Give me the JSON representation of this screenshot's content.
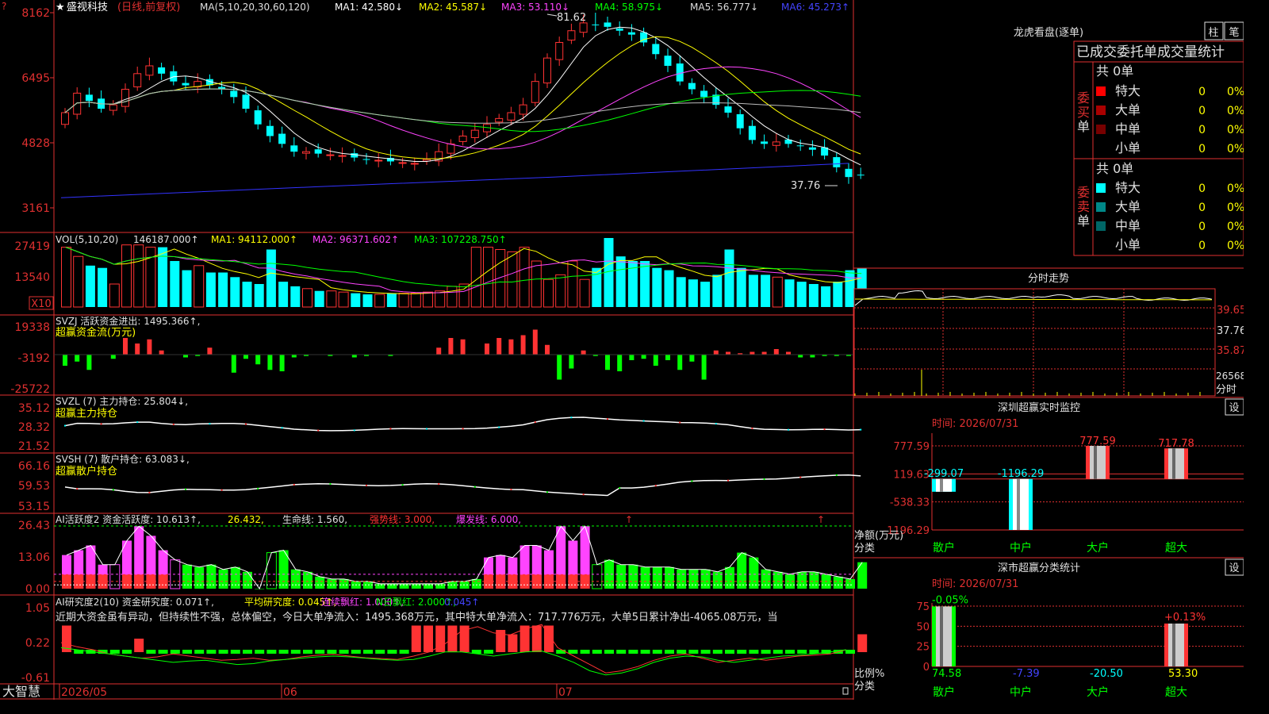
{
  "colors": {
    "up": "#ff3333",
    "down": "#00ffff",
    "axis": "#e03030",
    "text": "#e0e0e0",
    "yellow": "#ffff00",
    "green": "#00ff00",
    "magenta": "#ff44ff",
    "white": "#ffffff",
    "blue": "#3333ff"
  },
  "header": {
    "star": "★",
    "stock": "盛视科技",
    "mode": "(日线,前复权)",
    "ma_prefix": "MA(5,10,20,30,60,120)",
    "ma": [
      {
        "label": "MA1: 42.580↓",
        "color": "#ffffff"
      },
      {
        "label": "MA2: 45.587↓",
        "color": "#ffff00"
      },
      {
        "label": "MA3: 53.110↓",
        "color": "#ff44ff"
      },
      {
        "label": "MA4: 58.975↓",
        "color": "#00ff00"
      },
      {
        "label": "MA5: 56.777↓",
        "color": "#dddddd"
      },
      {
        "label": "MA6: 45.273↑",
        "color": "#4444ff"
      }
    ],
    "high_mark": "81.62",
    "low_mark": "37.76"
  },
  "price_axis": [
    "8162",
    "6495",
    "4828",
    "3161"
  ],
  "vol": {
    "axis": [
      "27419",
      "13540"
    ],
    "unit": "X10",
    "legend": [
      {
        "label": "VOL(5,10,20)",
        "color": "#e0e0e0"
      },
      {
        "label": "146187.000↑",
        "color": "#e0e0e0"
      },
      {
        "label": "MA1: 94112.000↑",
        "color": "#ffff00"
      },
      {
        "label": "MA2: 96371.602↑",
        "color": "#ff44ff"
      },
      {
        "label": "MA3: 107228.750↑",
        "color": "#00ff00"
      }
    ]
  },
  "svzj": {
    "axis": [
      "19338",
      "-3192",
      "-25722"
    ],
    "title": "SVZJ  活跃资金进出: 1495.366↑,",
    "subtitle": "超赢资金流(万元)"
  },
  "svzl": {
    "axis": [
      "35.12",
      "28.32",
      "21.52"
    ],
    "title": "SVZL (7) 主力持仓: 25.804↓,",
    "subtitle": "超赢主力持仓"
  },
  "svsh": {
    "axis": [
      "66.16",
      "59.53",
      "53.15"
    ],
    "title": "SVSH (7) 散户持仓: 63.083↓,",
    "subtitle": "超赢散户持仓"
  },
  "ai1": {
    "axis": [
      "26.43",
      "13.06",
      "0.00"
    ],
    "legend": [
      {
        "label": "AI活跃度2 资金活跃度: 10.613↑,",
        "color": "#e0e0e0"
      },
      {
        "label": "26.432,",
        "color": "#ffff00"
      },
      {
        "label": "生命线: 1.560,",
        "color": "#e0e0e0"
      },
      {
        "label": "强势线: 3.000,",
        "color": "#ff3333"
      },
      {
        "label": "爆发线: 6.000,",
        "color": "#ff44ff"
      }
    ]
  },
  "ai2": {
    "axis": [
      "1.05",
      "0.22",
      "-0.61"
    ],
    "legend": [
      {
        "label": "AI研究度2(10) 资金研究度: 0.071↑,",
        "color": "#e0e0e0"
      },
      {
        "label": "平均研究度: 0.045↑,",
        "color": "#ffff00"
      },
      {
        "label": "连续飘红: 1.000↑,",
        "color": "#ff44ff"
      },
      {
        "label": "N日飘红: 2.000↑,",
        "color": "#00ff00"
      },
      {
        "label": "0.045↑",
        "color": "#4444ff"
      }
    ],
    "commentary": "近期大资金虽有异动，但持续性不强，总体偏空，今日大单净流入：1495.368万元，其中特大单净流入：717.776万元，大单5日累计净出-4065.08万元，当"
  },
  "date_axis": [
    "2026/05",
    "06",
    "07"
  ],
  "brand": "大智慧",
  "right": {
    "dragon_title": "龙虎看盘(逐单)",
    "btn_zhu": "柱",
    "btn_bi": "笔",
    "stat_title": "已成交委托单成交量统计",
    "buy_label": "委买单",
    "sell_label": "委卖单",
    "buy_count": "共 0单",
    "sell_count": "共 0单",
    "buy_rows": [
      {
        "label": "特大",
        "value": "0",
        "pct": "0%",
        "color": "#ff0000"
      },
      {
        "label": "大单",
        "value": "0",
        "pct": "0%",
        "color": "#aa0000"
      },
      {
        "label": "中单",
        "value": "0",
        "pct": "0%",
        "color": "#770000"
      },
      {
        "label": "小单",
        "value": "0",
        "pct": "0%",
        "color": "#000000"
      }
    ],
    "sell_rows": [
      {
        "label": "特大",
        "value": "0",
        "pct": "0%",
        "color": "#00ffff"
      },
      {
        "label": "大单",
        "value": "0",
        "pct": "0%",
        "color": "#008888"
      },
      {
        "label": "中单",
        "value": "0",
        "pct": "0%",
        "color": "#006666"
      },
      {
        "label": "小单",
        "value": "0",
        "pct": "0%",
        "color": "#000000"
      }
    ],
    "fenshi_title": "分时走势",
    "fenshi_axis": [
      "39.65",
      "37.76",
      "35.87"
    ],
    "fenshi_vol_axis": "26568",
    "fenshi_unit": "分时",
    "monitor_title": "深圳超赢实时监控",
    "monitor_set": "设",
    "monitor_time": "时间: 2026/07/31",
    "monitor_axis": [
      "777.59",
      "119.63",
      "-538.33",
      "-1196.29"
    ],
    "monitor_ylabel": "净额(万元)",
    "monitor_xlabel": "分类",
    "monitor_cats": [
      "散户",
      "中户",
      "大户",
      "超大"
    ],
    "monitor_vals": [
      -299.07,
      -1196.29,
      777.59,
      717.78
    ],
    "monitor_val_labels": [
      "-299.07",
      "-1196.29",
      "777.59",
      "717.78"
    ],
    "class_title": "深市超赢分类统计",
    "class_set": "设",
    "class_time": "时间: 2026/07/31",
    "class_axis": [
      "75",
      "50",
      "25",
      "0"
    ],
    "class_ylabel": "比例%",
    "class_xlabel": "分类",
    "class_cats": [
      "散户",
      "中户",
      "大户",
      "超大"
    ],
    "class_vals": [
      74.58,
      -7.39,
      -20.5,
      53.3
    ],
    "class_val_labels": [
      "74.58",
      "-7.39",
      "-20.50",
      "53.30"
    ],
    "class_pct_labels": [
      "-0.05%",
      "",
      "",
      "+0.13%"
    ]
  }
}
